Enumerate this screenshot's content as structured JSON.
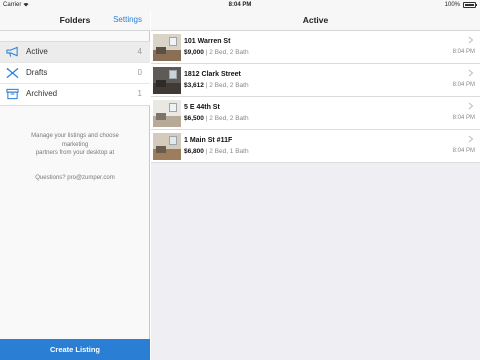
{
  "status_bar": {
    "carrier": "Carrier",
    "time": "8:04 PM",
    "battery": "100%"
  },
  "sidebar": {
    "title": "Folders",
    "settings_label": "Settings",
    "folders": [
      {
        "label": "Active",
        "count": "4",
        "icon": "megaphone-icon"
      },
      {
        "label": "Drafts",
        "count": "0",
        "icon": "pencil-ruler-icon"
      },
      {
        "label": "Archived",
        "count": "1",
        "icon": "archive-box-icon"
      }
    ],
    "info_lines": [
      "Manage your listings and choose",
      "marketing",
      "partners from your desktop at"
    ],
    "questions": "Questions? pro@zumper.com",
    "create_label": "Create Listing"
  },
  "main": {
    "title": "Active",
    "listings": [
      {
        "address": "101 Warren St",
        "price": "$9,000",
        "details": "2 Bed, 2 Bath",
        "time": "8:04 PM"
      },
      {
        "address": "1812 Clark Street",
        "price": "$3,612",
        "details": "2 Bed, 2 Bath",
        "time": "8:04 PM"
      },
      {
        "address": "5 E 44th St",
        "price": "$6,500",
        "details": "2 Bed, 2 Bath",
        "time": "8:04 PM"
      },
      {
        "address": "1 Main St #11F",
        "price": "$6,800",
        "details": "2 Bed, 1 Bath",
        "time": "8:04 PM"
      }
    ]
  },
  "colors": {
    "accent": "#2a7fd4",
    "sidebar_bg": "#f9f9f9",
    "content_bg": "#efeff3"
  }
}
